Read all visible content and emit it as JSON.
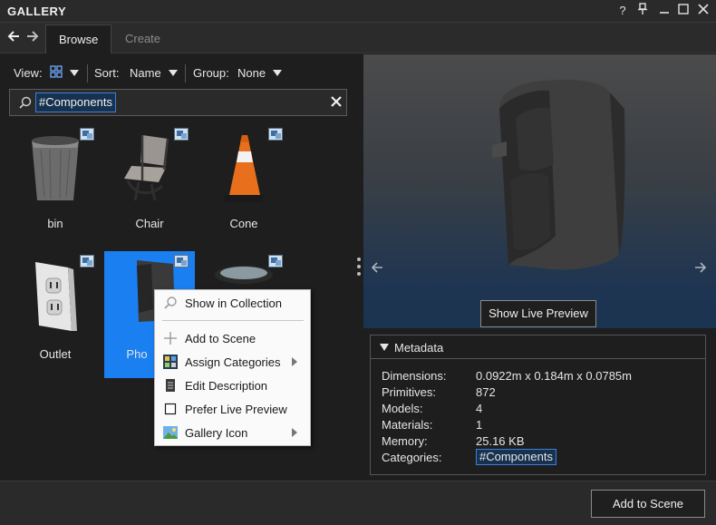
{
  "window": {
    "title": "GALLERY",
    "controls": [
      {
        "name": "help",
        "glyph": "?"
      },
      {
        "name": "pin",
        "glyph": "⊥"
      },
      {
        "name": "minimize",
        "glyph": "—"
      },
      {
        "name": "maximize",
        "glyph": "☐"
      },
      {
        "name": "close",
        "glyph": "✕"
      }
    ]
  },
  "tabs": [
    {
      "label": "Browse",
      "active": true
    },
    {
      "label": "Create",
      "active": false
    }
  ],
  "toolbar": {
    "view_label": "View:",
    "sort_label": "Sort:",
    "sort_value": "Name",
    "group_label": "Group:",
    "group_value": "None"
  },
  "search": {
    "token": "#Components"
  },
  "items": [
    {
      "label": "bin",
      "selected": false
    },
    {
      "label": "Chair",
      "selected": false
    },
    {
      "label": "Cone",
      "selected": false
    },
    {
      "label": "Outlet",
      "selected": false
    },
    {
      "label": "Pho",
      "selected": true
    },
    {
      "label": "",
      "selected": false
    }
  ],
  "context_menu": {
    "items": [
      {
        "label": "Show in Collection",
        "icon": "search-icon",
        "submenu": false
      },
      {
        "label": "Add to Scene",
        "icon": "plus-icon",
        "submenu": false
      },
      {
        "label": "Assign Categories",
        "icon": "categories-icon",
        "submenu": true
      },
      {
        "label": "Edit Description",
        "icon": "document-icon",
        "submenu": false
      },
      {
        "label": "Prefer Live Preview",
        "icon": "checkbox-icon",
        "submenu": false
      },
      {
        "label": "Gallery Icon",
        "icon": "image-icon",
        "submenu": true
      }
    ]
  },
  "preview": {
    "live_button": "Show Live Preview",
    "bg_top": "#4b4b4b",
    "bg_bottom": "#1a3350"
  },
  "metadata": {
    "title": "Metadata",
    "rows": [
      {
        "key": "Dimensions:",
        "value": "0.0922m x 0.184m x 0.0785m"
      },
      {
        "key": "Primitives:",
        "value": "872"
      },
      {
        "key": "Models:",
        "value": "4"
      },
      {
        "key": "Materials:",
        "value": "1"
      },
      {
        "key": "Memory:",
        "value": "25.16 KB"
      },
      {
        "key": "Categories:",
        "value": "#Components"
      }
    ]
  },
  "footer": {
    "add_button": "Add to Scene"
  },
  "colors": {
    "accent": "#1a7ff0",
    "token_border": "#3f7fd6",
    "background": "#1e1e1e"
  }
}
